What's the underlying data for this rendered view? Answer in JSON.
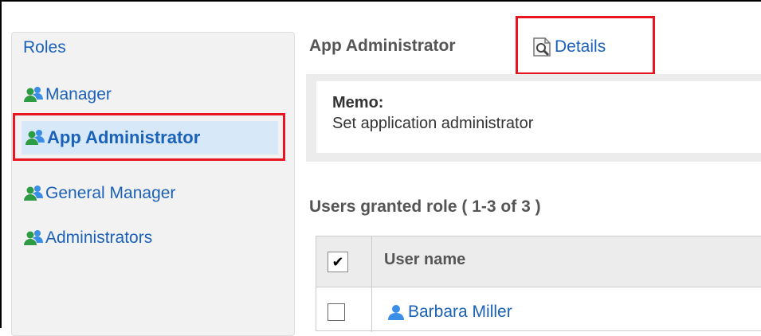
{
  "sidebar": {
    "title": "Roles",
    "items": [
      {
        "label": "Manager",
        "icon": "group-icon"
      },
      {
        "label": "App Administrator",
        "icon": "group-icon",
        "selected": true
      },
      {
        "label": "General Manager",
        "icon": "group-icon"
      },
      {
        "label": "Administrators",
        "icon": "group-icon"
      }
    ]
  },
  "main": {
    "title": "App Administrator",
    "details_label": "Details",
    "memo": {
      "label": "Memo:",
      "text": "Set application administrator"
    },
    "users_heading": "Users granted role ( 1-3 of 3 )",
    "table": {
      "header_check": "✔",
      "column_username": "User name",
      "rows": [
        {
          "name": "Barbara Miller",
          "icon": "user-icon"
        }
      ]
    }
  },
  "colors": {
    "link": "#1a61b8",
    "highlight": "#e8141f",
    "selected_bg": "#d7e8f8",
    "icon_green": "#2e9b45",
    "icon_blue": "#3a8ee6"
  }
}
